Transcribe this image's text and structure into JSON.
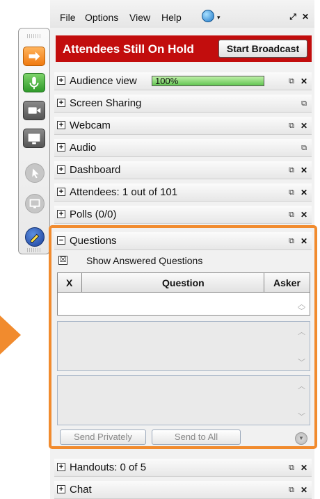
{
  "menu": {
    "items": [
      "File",
      "Options",
      "View",
      "Help"
    ],
    "globe_caret": "▾",
    "popout": "⤢",
    "close": "✕"
  },
  "banner": {
    "text": "Attendees Still On Hold",
    "button_label": "Start Broadcast",
    "color": "#c20d0d"
  },
  "panels": [
    {
      "label": "Audience view",
      "progress": 100,
      "progress_label": "100%",
      "popout": "⧉",
      "close": "✕"
    },
    {
      "label": "Screen Sharing",
      "popout": "⧉"
    },
    {
      "label": "Webcam",
      "popout": "⧉",
      "close": "✕"
    },
    {
      "label": "Audio",
      "popout": "⧉"
    },
    {
      "label": "Dashboard",
      "popout": "⧉",
      "close": "✕"
    },
    {
      "label": "Attendees:  1 out of 101",
      "popout": "⧉",
      "close": "✕"
    },
    {
      "label": "Polls (0/0)",
      "popout": "⧉",
      "close": "✕"
    }
  ],
  "questions": {
    "label": "Questions",
    "toggle": "−",
    "popout": "⧉",
    "close": "✕",
    "show_answered_checkbox": "☒",
    "show_answered_label": "Show Answered Questions",
    "columns": [
      "X",
      "Question",
      "Asker"
    ],
    "send_privately": "Send Privately",
    "send_to_all": "Send to All",
    "accent": "#f18b2e"
  },
  "bottom_panels": [
    {
      "label": "Handouts: 0 of 5",
      "popout": "⧉",
      "close": "✕"
    },
    {
      "label": "Chat",
      "popout": "⧉",
      "close": "✕"
    }
  ],
  "toolbar_icons": [
    "arrow-icon",
    "microphone-icon",
    "webcam-icon",
    "screen-icon",
    "pointer-icon",
    "screen-share-icon",
    "drawing-tool-icon"
  ]
}
